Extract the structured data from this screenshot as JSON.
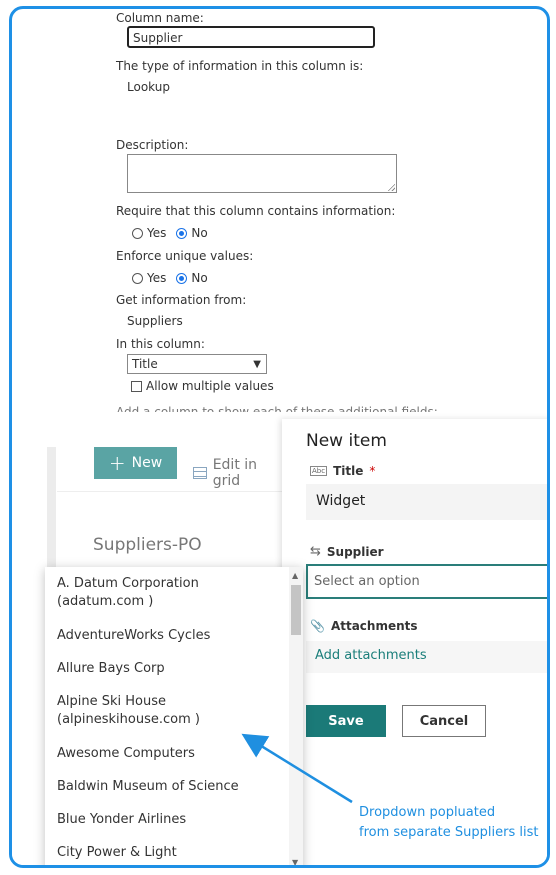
{
  "settings": {
    "column_name_label": "Column name:",
    "column_name_value": "Supplier",
    "type_label": "The type of information in this column is:",
    "type_value": "Lookup",
    "description_label": "Description:",
    "require_label": "Require that this column contains information:",
    "require_yes": "Yes",
    "require_no": "No",
    "unique_label": "Enforce unique values:",
    "unique_yes": "Yes",
    "unique_no": "No",
    "get_info_label": "Get information from:",
    "get_info_value": "Suppliers",
    "in_column_label": "In this column:",
    "in_column_value": "Title",
    "allow_multiple_label": "Allow multiple values",
    "cutoff_text": "Add a column to show each of these additional fields:"
  },
  "toolbar": {
    "new_label": "New",
    "grid_label": "Edit in grid"
  },
  "list": {
    "title": "Suppliers-PO"
  },
  "dropdown": {
    "items": [
      "A. Datum Corporation",
      "(adatum.com )",
      "AdventureWorks Cycles",
      "Allure Bays Corp",
      "Alpine Ski House",
      "(alpineskihouse.com )",
      "Awesome Computers",
      "Baldwin Museum of Science",
      "Blue Yonder Airlines",
      "City Power & Light"
    ]
  },
  "panel": {
    "title": "New item",
    "title_field_label": "Title",
    "required_mark": "*",
    "title_field_value": "Widget",
    "supplier_label": "Supplier",
    "supplier_placeholder": "Select an option",
    "attachments_label": "Attachments",
    "add_attachments": "Add attachments",
    "save_label": "Save",
    "cancel_label": "Cancel"
  },
  "annotation": {
    "line1": "Dropdown popluated",
    "line2": "from separate Suppliers list"
  },
  "colors": {
    "frame_border": "#1e90e6",
    "accent_teal": "#1b7a78",
    "annotation_blue": "#1f8fe0"
  }
}
